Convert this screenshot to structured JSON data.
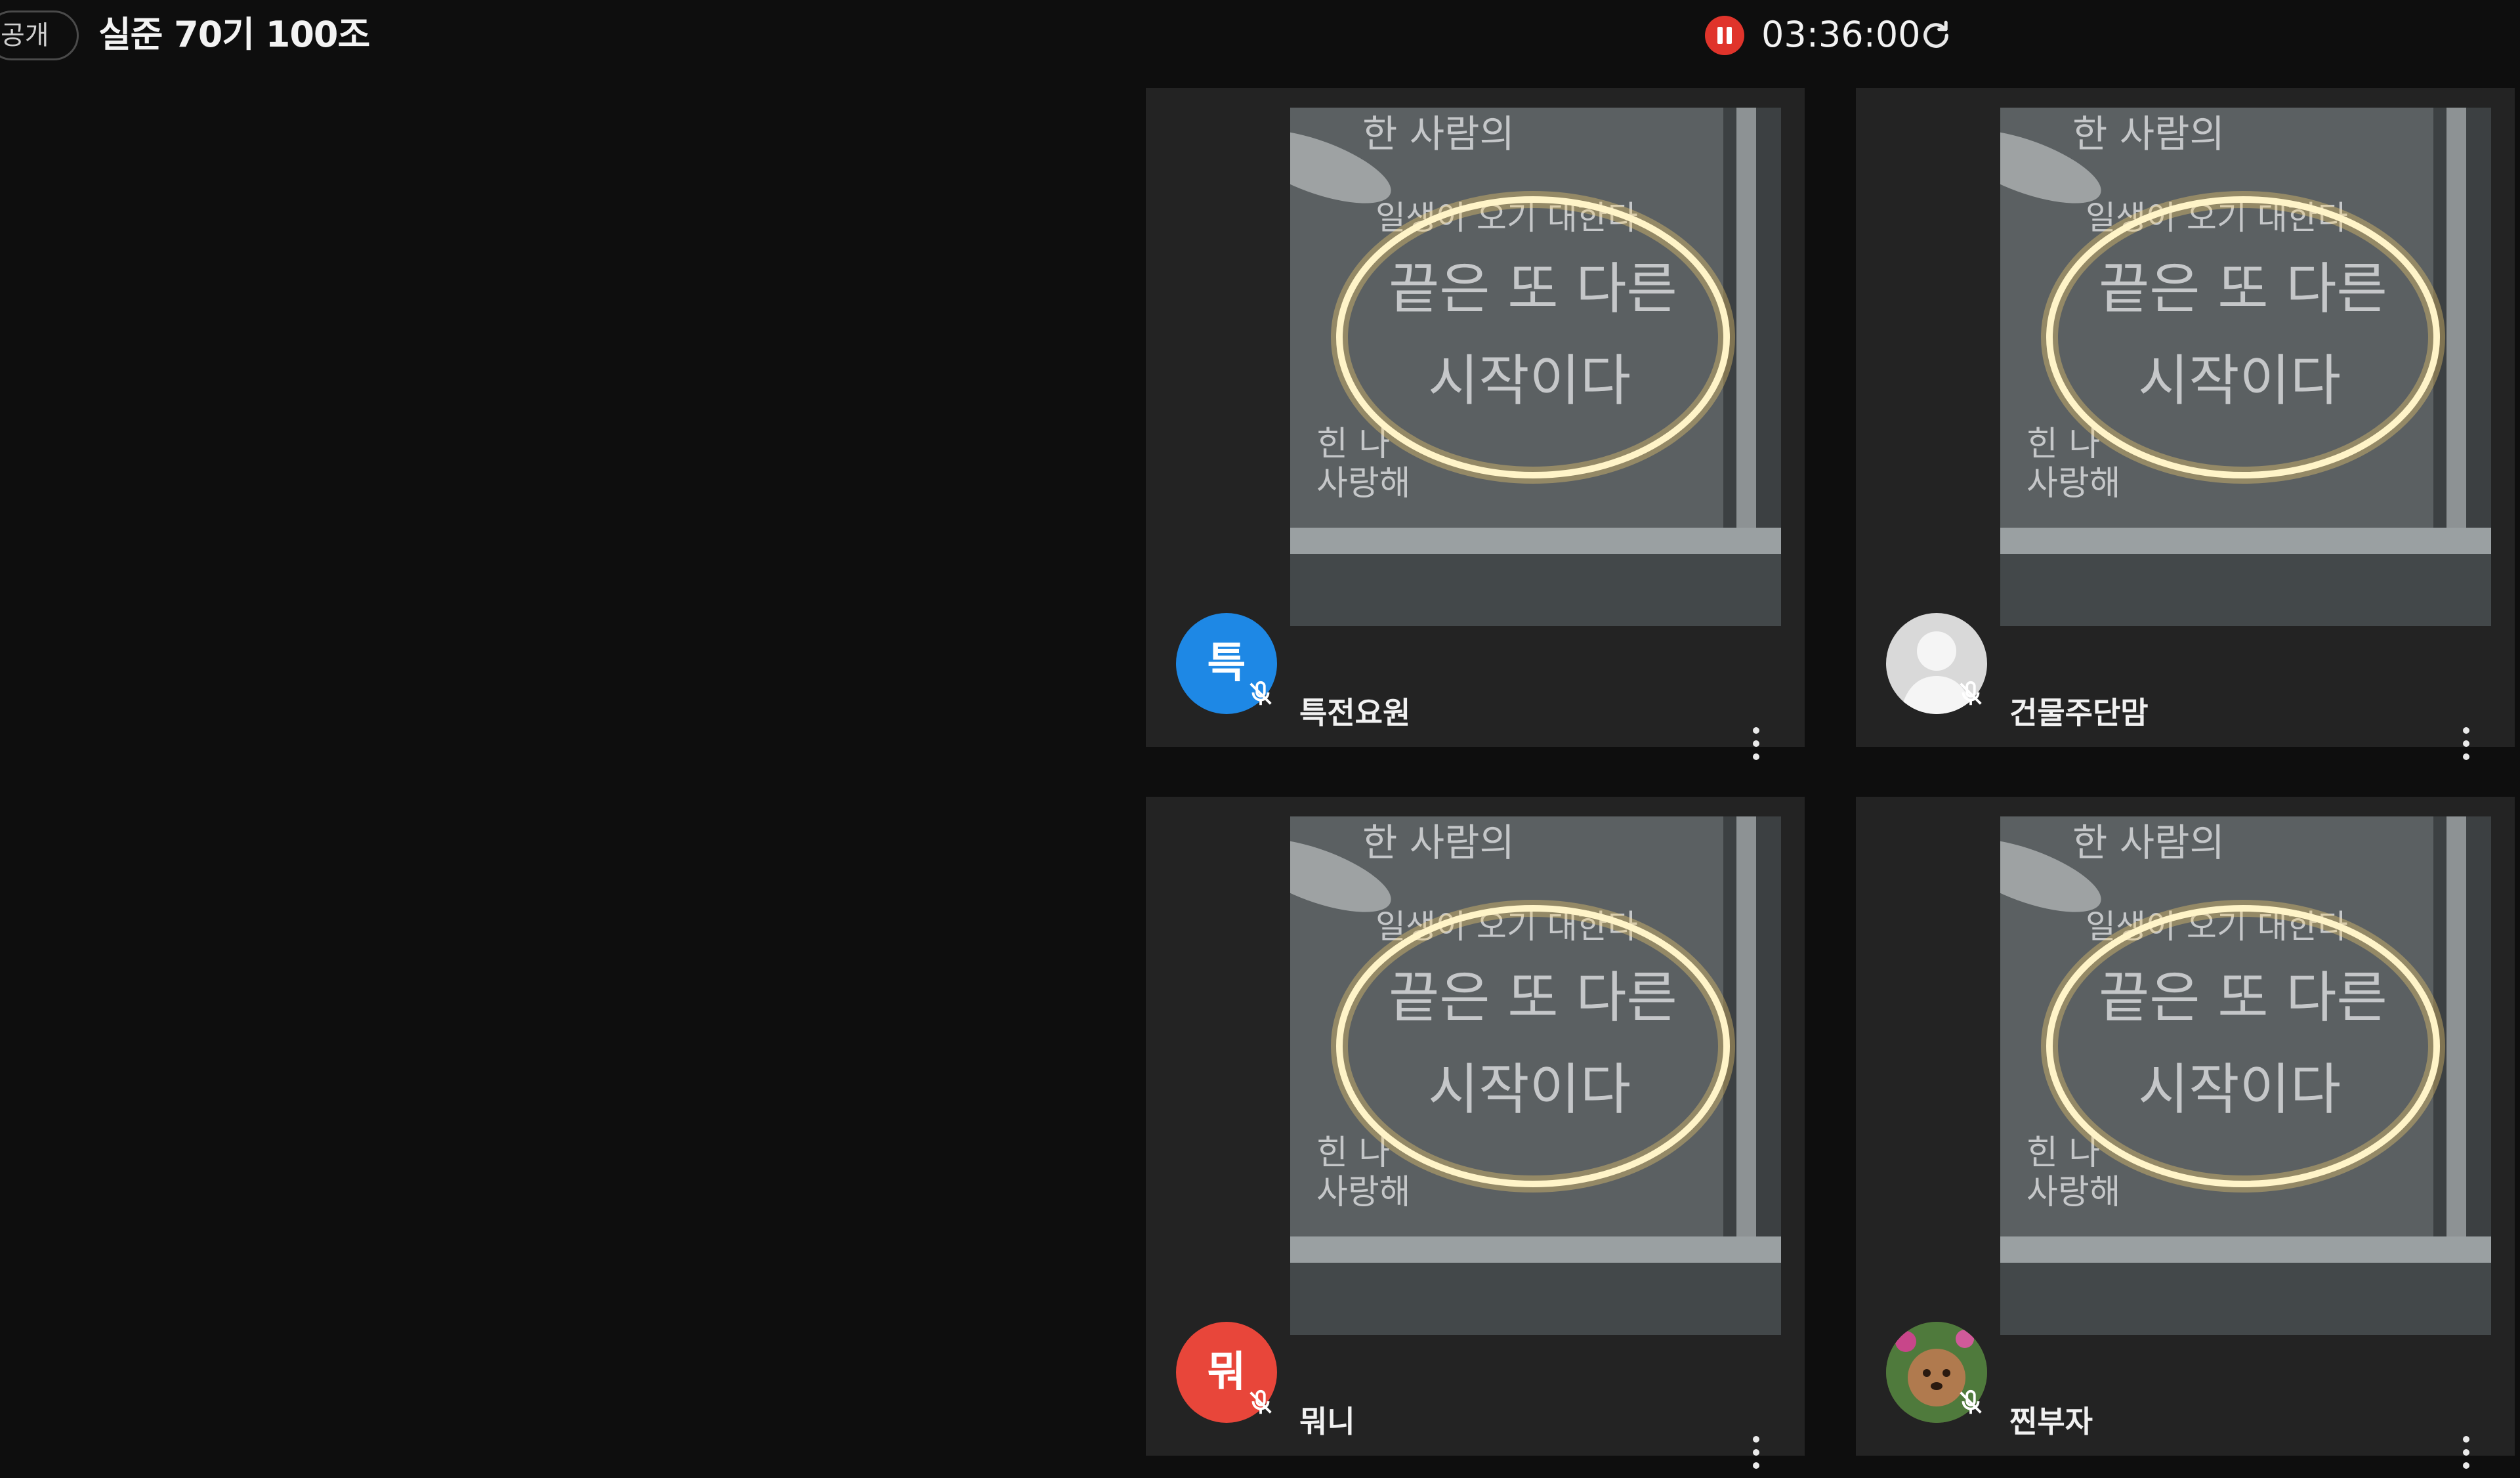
{
  "header": {
    "visibility_badge": "공개",
    "room_title": "실준 70기 100조",
    "timer": "03:36:00",
    "icons": {
      "pause": "pause-icon",
      "refresh": "refresh-icon"
    },
    "pause_color": "#e0342b"
  },
  "participants": [
    {
      "name": "특전요원",
      "avatar_text": "특",
      "avatar_type": "letter",
      "avatar_color": "#1e88e5",
      "mic": "muted"
    },
    {
      "name": "건물주단맘",
      "avatar_text": "",
      "avatar_type": "default-person",
      "avatar_color": "#d9d9d9",
      "mic": "muted"
    },
    {
      "name": "뭐니",
      "avatar_text": "뭐",
      "avatar_type": "letter",
      "avatar_color": "#e8463a",
      "mic": "muted"
    },
    {
      "name": "찐부자",
      "avatar_text": "",
      "avatar_type": "photo",
      "avatar_color": "#7a5a3a",
      "mic": "muted"
    }
  ],
  "stream_board_text": [
    "한 사람의",
    "일생이 오기 대한다",
    "끝은 또 다른",
    "시작이다",
    "힌 나",
    "사랑해"
  ],
  "colors": {
    "background": "#0e0e0e",
    "tile": "#232323",
    "glow": "#ffe6a0"
  }
}
